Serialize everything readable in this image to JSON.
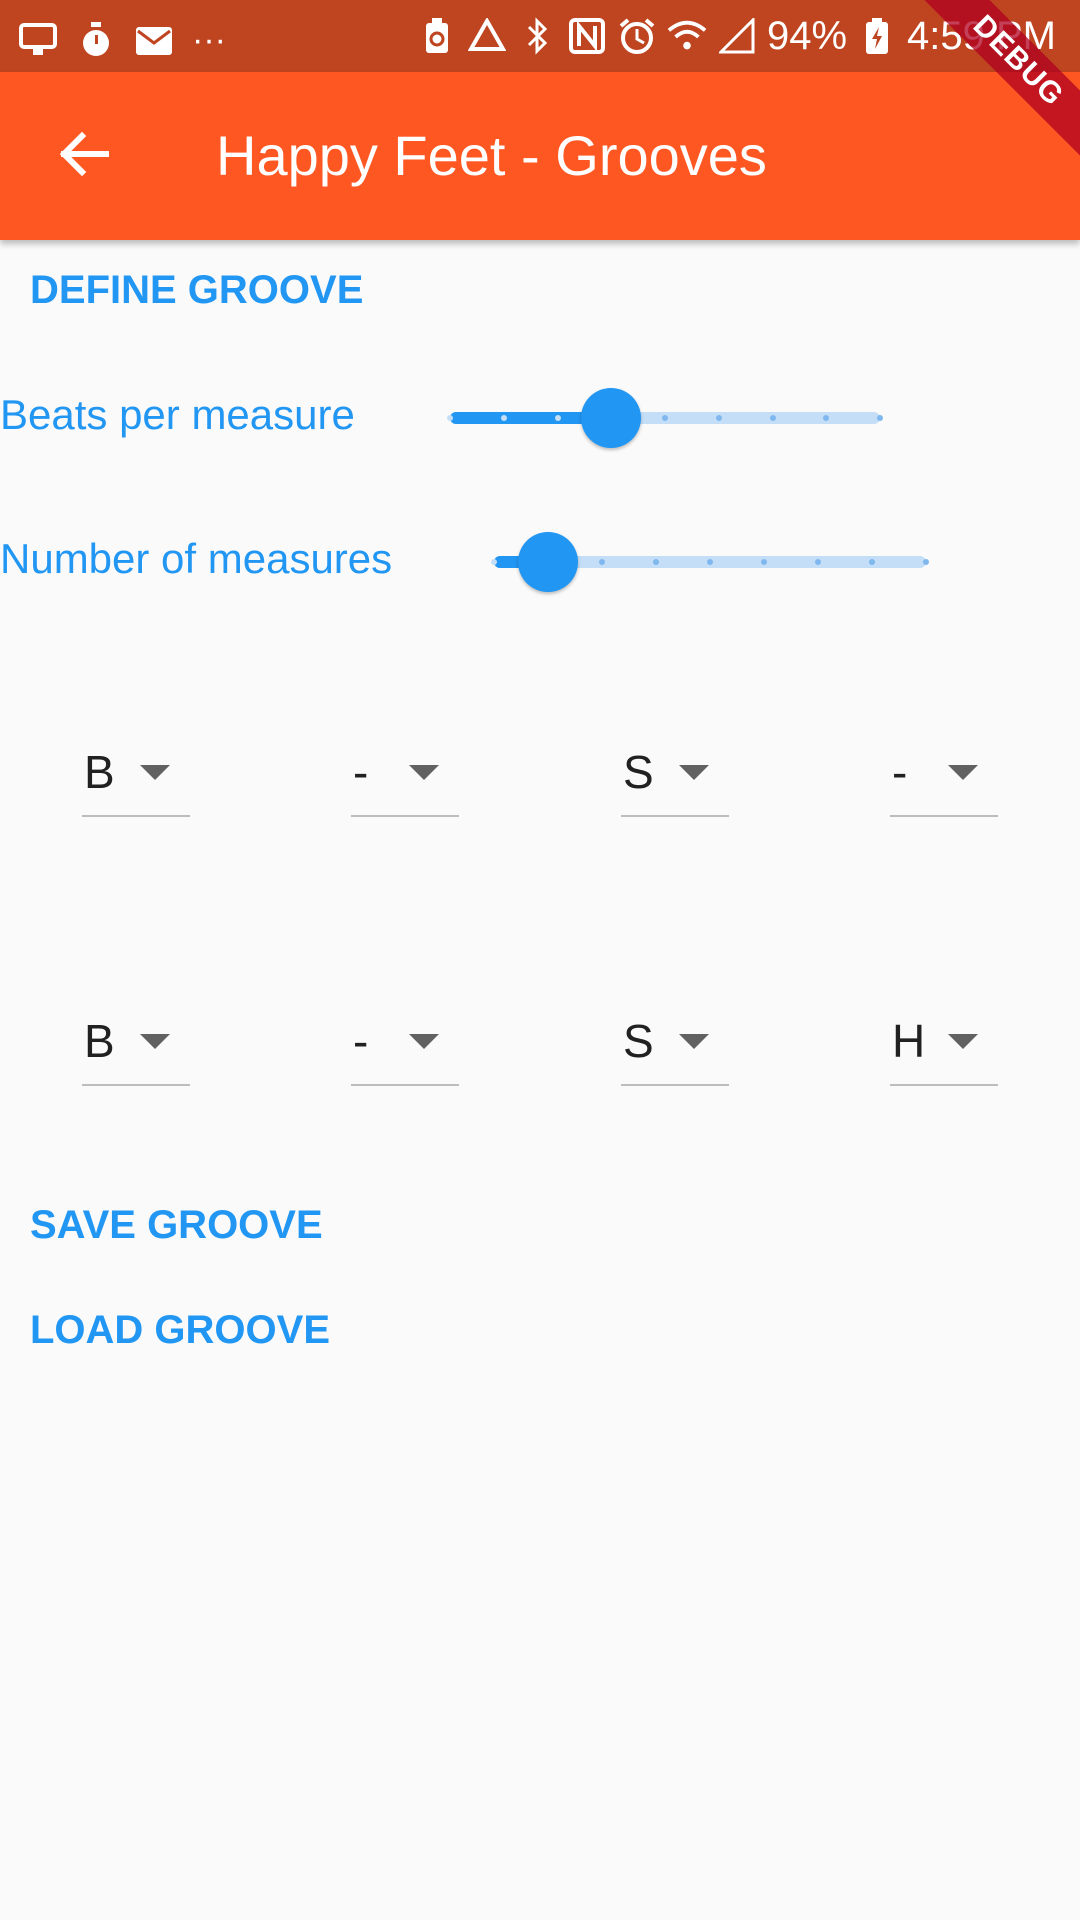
{
  "status_bar": {
    "battery_text": "94%",
    "time": "4:59 PM",
    "overflow_dots": "···"
  },
  "app_bar": {
    "title": "Happy Feet - Grooves"
  },
  "debug_banner": {
    "label": "DEBUG"
  },
  "define_groove_label": "DEFINE GROOVE",
  "beats_per_measure": {
    "label": "Beats per measure",
    "value_fraction": 0.375
  },
  "number_of_measures": {
    "label": "Number of measures",
    "value_fraction": 0.125
  },
  "groove_rows": [
    [
      "B",
      "-",
      "S",
      "-"
    ],
    [
      "B",
      "-",
      "S",
      "H"
    ]
  ],
  "save_groove_label": "SAVE GROOVE",
  "load_groove_label": "LOAD GROOVE",
  "colors": {
    "status_bar": "#bf4420",
    "app_bar": "#ff5722",
    "accent": "#2196f3",
    "track_inactive": "#c4def7"
  },
  "icons": {
    "back": "arrow-back-icon",
    "dropdown": "arrow-drop-down-icon"
  }
}
